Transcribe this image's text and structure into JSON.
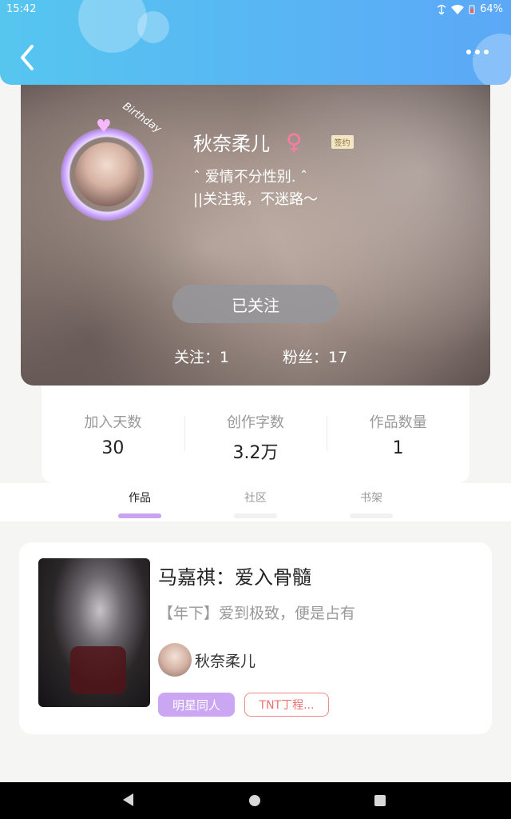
{
  "status_bar": {
    "time": "15:42",
    "battery": "64%"
  },
  "header": {
    "back_icon": "chevron-left-icon",
    "more_icon": "more-dots-icon"
  },
  "profile": {
    "name": "秋奈柔儿",
    "gender_symbol": "♀",
    "gender_color": "#ff7aa2",
    "sign_badge": "签约",
    "bio_line1": "ˆ 爱情不分性别. ˆ",
    "bio_line2": "||关注我，不迷路～",
    "avatar_heart": "♥",
    "avatar_text": "Birthday",
    "follow_button": "已关注",
    "following": "关注：1",
    "fans": "粉丝：17"
  },
  "stats": [
    {
      "label": "加入天数",
      "value": "30"
    },
    {
      "label": "创作字数",
      "value": "3.2万"
    },
    {
      "label": "作品数量",
      "value": "1"
    }
  ],
  "tabs": [
    {
      "label": "作品",
      "active": true
    },
    {
      "label": "社区",
      "active": false
    },
    {
      "label": "书架",
      "active": false
    }
  ],
  "book": {
    "title": "马嘉祺：爱入骨髓",
    "description": "【年下】爱到极致，便是占有",
    "author": "秋奈柔儿",
    "tags": [
      "明星同人",
      "TNT丁程..."
    ]
  },
  "colors": {
    "header_start": "#56c6ef",
    "header_end": "#5ba8f7",
    "accent_purple": "#c8a3f0",
    "tag_red": "#f07070"
  }
}
